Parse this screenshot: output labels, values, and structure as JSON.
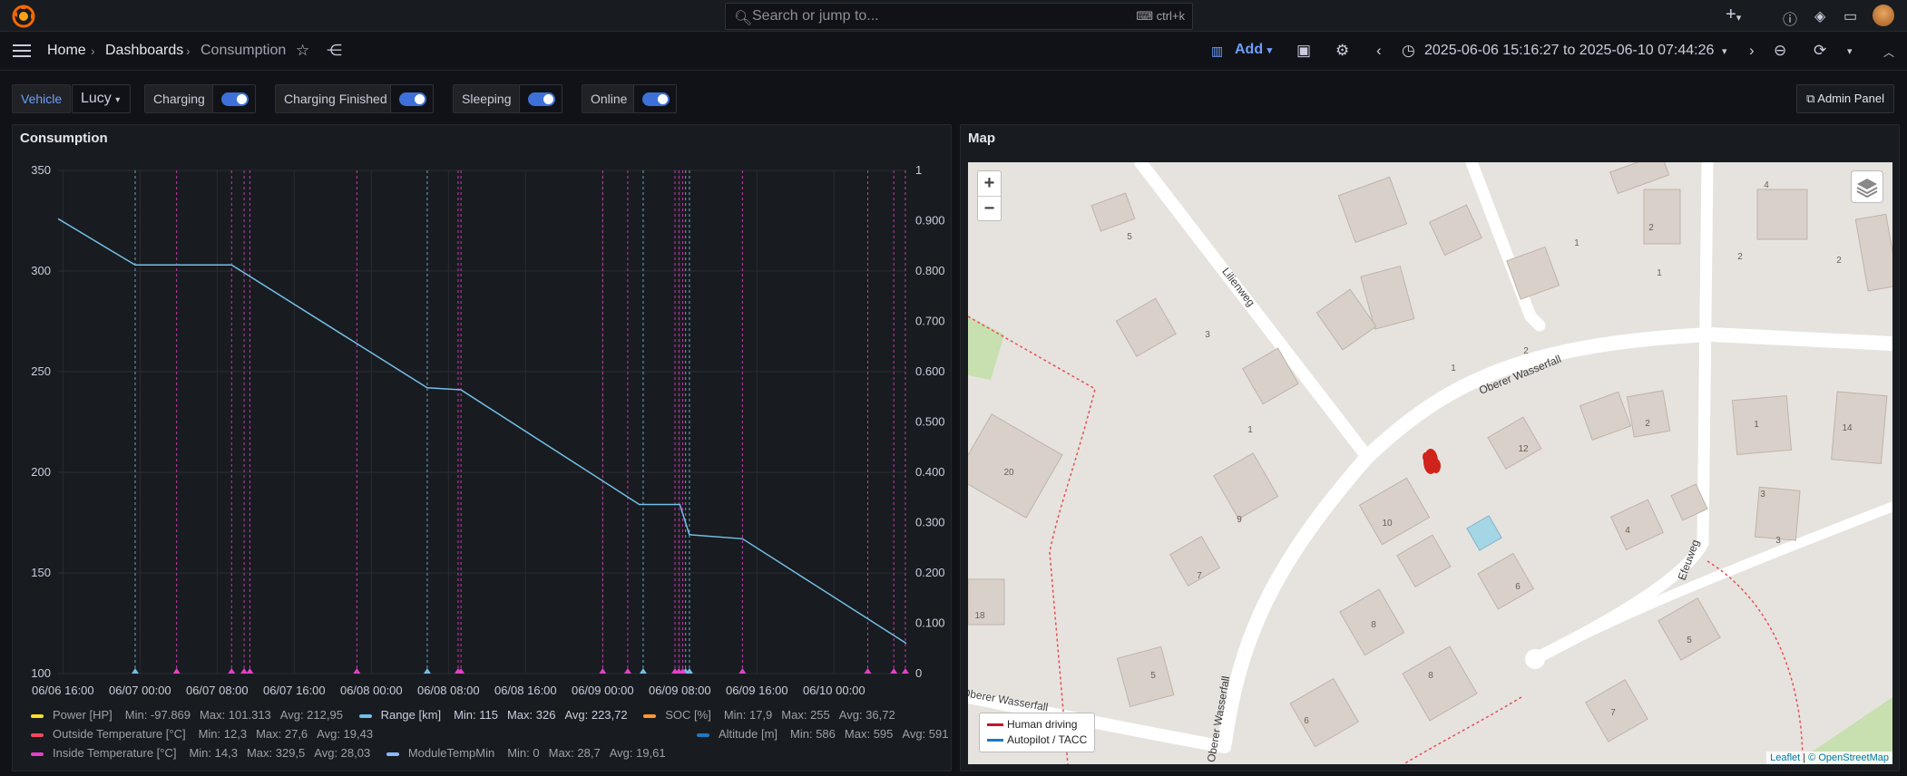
{
  "search": {
    "placeholder": "Search or jump to...",
    "shortcut": "ctrl+k"
  },
  "nav": {
    "home": "Home",
    "dashboards": "Dashboards",
    "current": "Consumption",
    "add": "Add",
    "time_range": "2025-06-06 15:16:27 to 2025-06-10 07:44:26"
  },
  "variables": {
    "vehicle_label": "Vehicle",
    "vehicle_value": "Lucy",
    "charging_label": "Charging",
    "charging_on": true,
    "charging_finished_label": "Charging Finished",
    "charging_finished_on": true,
    "sleeping_label": "Sleeping",
    "sleeping_on": true,
    "online_label": "Online",
    "online_on": true,
    "admin_panel": "Admin Panel"
  },
  "consumption_panel": {
    "title": "Consumption",
    "legend": [
      {
        "name": "Power [HP]",
        "color": "#fade2a",
        "min": "Min: -97.869",
        "max": "Max: 101.313",
        "avg": "Avg: 212,95"
      },
      {
        "name": "Range [km]",
        "color": "#73bfe8",
        "min": "Min: 115",
        "max": "Max: 326",
        "avg": "Avg: 223,72"
      },
      {
        "name": "SOC [%]",
        "color": "#ff9830",
        "min": "Min: 17,9",
        "max": "Max: 255",
        "avg": "Avg: 36,72"
      },
      {
        "name": "Outside Temperature [°C]",
        "color": "#f2495c",
        "min": "Min: 12,3",
        "max": "Max: 27,6",
        "avg": "Avg: 19,43"
      },
      {
        "name": "Altitude [m]",
        "color": "#1f78c1",
        "min": "Min: 586",
        "max": "Max: 595",
        "avg": "Avg: 591"
      },
      {
        "name": "Inside Temperature [°C]",
        "color": "#e540c9",
        "min": "Min: 14,3",
        "max": "Max: 329,5",
        "avg": "Avg: 28,03"
      },
      {
        "name": "ModuleTempMin",
        "color": "#8ab8ff",
        "min": "Min: 0",
        "max": "Max: 28,7",
        "avg": "Avg: 19,61"
      }
    ]
  },
  "chart_data": {
    "type": "line",
    "title": "Consumption",
    "x_tick_labels": [
      "06/06 16:00",
      "06/07 00:00",
      "06/07 08:00",
      "06/07 16:00",
      "06/08 00:00",
      "06/08 08:00",
      "06/08 16:00",
      "06/09 00:00",
      "06/09 08:00",
      "06/09 16:00",
      "06/10 00:00"
    ],
    "y_left": {
      "ylim": [
        100,
        350
      ],
      "ticks": [
        "350",
        "300",
        "250",
        "200",
        "150",
        "100"
      ]
    },
    "y_right": {
      "ylim": [
        0,
        1
      ],
      "ticks": [
        "1",
        "0.900",
        "0.800",
        "0.700",
        "0.600",
        "0.500",
        "0.400",
        "0.300",
        "0.200",
        "0.100",
        "0"
      ]
    },
    "x_range_hours": [
      -0.5,
      87.5
    ],
    "grid": true,
    "series": [
      {
        "name": "Range [km]",
        "color": "#73bfe8",
        "x_hours": [
          -0.5,
          7.5,
          17.5,
          37.8,
          41.3,
          59.8,
          64.0,
          65.0,
          70.5,
          87.5
        ],
        "values": [
          326,
          303,
          303,
          242,
          241,
          184,
          184,
          169,
          167,
          115
        ]
      }
    ],
    "event_markers": {
      "cyan_hours": [
        7.5,
        37.8,
        60.2,
        64.6,
        65.0
      ],
      "magenta_hours": [
        11.8,
        17.5,
        18.8,
        19.4,
        30.5,
        41.0,
        41.3,
        56.0,
        58.6,
        63.5,
        63.9,
        64.3,
        70.5,
        83.5,
        86.2,
        87.4
      ],
      "colors": {
        "cyan": "#73bfe8",
        "magenta": "#e540c9"
      }
    }
  },
  "map_panel": {
    "title": "Map",
    "zoom_in": "+",
    "zoom_out": "−",
    "street_labels": [
      "Lilienweg",
      "Oberer Wasserfall",
      "Efeuweg",
      "Oberer Wasserfall",
      "Oberer Wasserfall"
    ],
    "house_numbers": [
      "5",
      "3",
      "1",
      "2",
      "1",
      "4",
      "2",
      "1",
      "2",
      "3",
      "2",
      "1",
      "20",
      "9",
      "7",
      "18",
      "5",
      "10",
      "12",
      "2",
      "1",
      "14",
      "3",
      "3",
      "4",
      "6",
      "8",
      "8",
      "6",
      "7",
      "5"
    ],
    "legend": {
      "human": "Human driving",
      "autopilot": "Autopilot / TACC"
    },
    "attribution_leaflet": "Leaflet",
    "attribution_osm": "© OpenStreetMap",
    "colors": {
      "human": "#c4162a",
      "autopilot": "#1f78c1"
    }
  }
}
